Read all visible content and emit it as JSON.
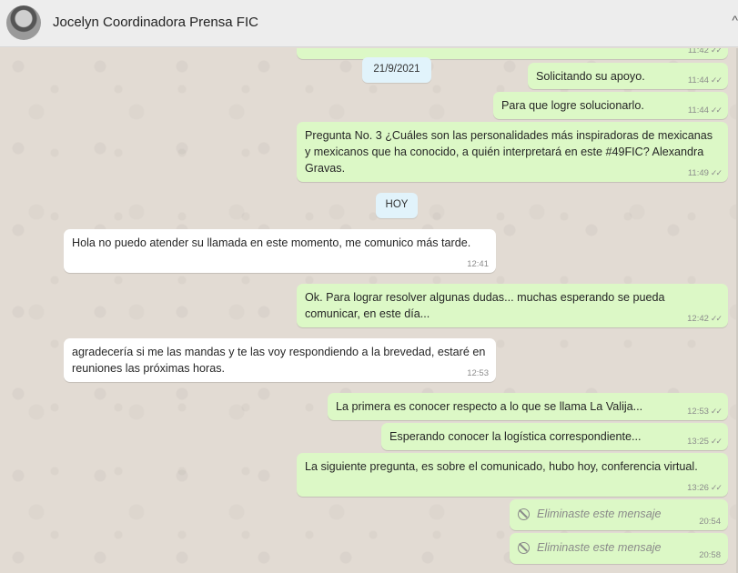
{
  "header": {
    "contact_name": "Jocelyn Coordinadora Prensa FIC",
    "chevron": "^"
  },
  "messages": {
    "m0": {
      "time": "11:42",
      "ticks": "✓✓"
    },
    "d1": {
      "label": "21/9/2021"
    },
    "m1": {
      "text": "Solicitando su apoyo.",
      "time": "11:44",
      "ticks": "✓✓"
    },
    "m2": {
      "text": "Para que logre solucionarlo.",
      "time": "11:44",
      "ticks": "✓✓"
    },
    "m3": {
      "text": "Pregunta No. 3 ¿Cuáles son las personalidades más inspiradoras de mexicanas y mexicanos que ha conocido, a quién interpretará en este #49FIC? Alexandra Gravas.",
      "time": "11:49",
      "ticks": "✓✓"
    },
    "d2": {
      "label": "HOY"
    },
    "m4": {
      "text": "Hola no puedo atender su llamada en este momento, me comunico más tarde.",
      "time": "12:41"
    },
    "m5": {
      "text": "Ok. Para lograr resolver algunas dudas... muchas esperando se pueda comunicar, en este día...",
      "time": "12:42",
      "ticks": "✓✓"
    },
    "m6": {
      "text": "agradecería si me las mandas y te las voy respondiendo a la brevedad, estaré en reuniones las próximas horas.",
      "time": "12:53"
    },
    "m7": {
      "text": "La primera es conocer respecto a lo que se llama La Valija...",
      "time": "12:53",
      "ticks": "✓✓"
    },
    "m8": {
      "text": "Esperando conocer la logística correspondiente...",
      "time": "13:25",
      "ticks": "✓✓"
    },
    "m9": {
      "text": "La siguiente pregunta, es sobre el comunicado, hubo hoy, conferencia virtual.",
      "time": "13:26",
      "ticks": "✓✓"
    },
    "m10": {
      "text": "Eliminaste este mensaje",
      "time": "20:54"
    },
    "m11": {
      "text": "Eliminaste este mensaje",
      "time": "20:58"
    }
  }
}
